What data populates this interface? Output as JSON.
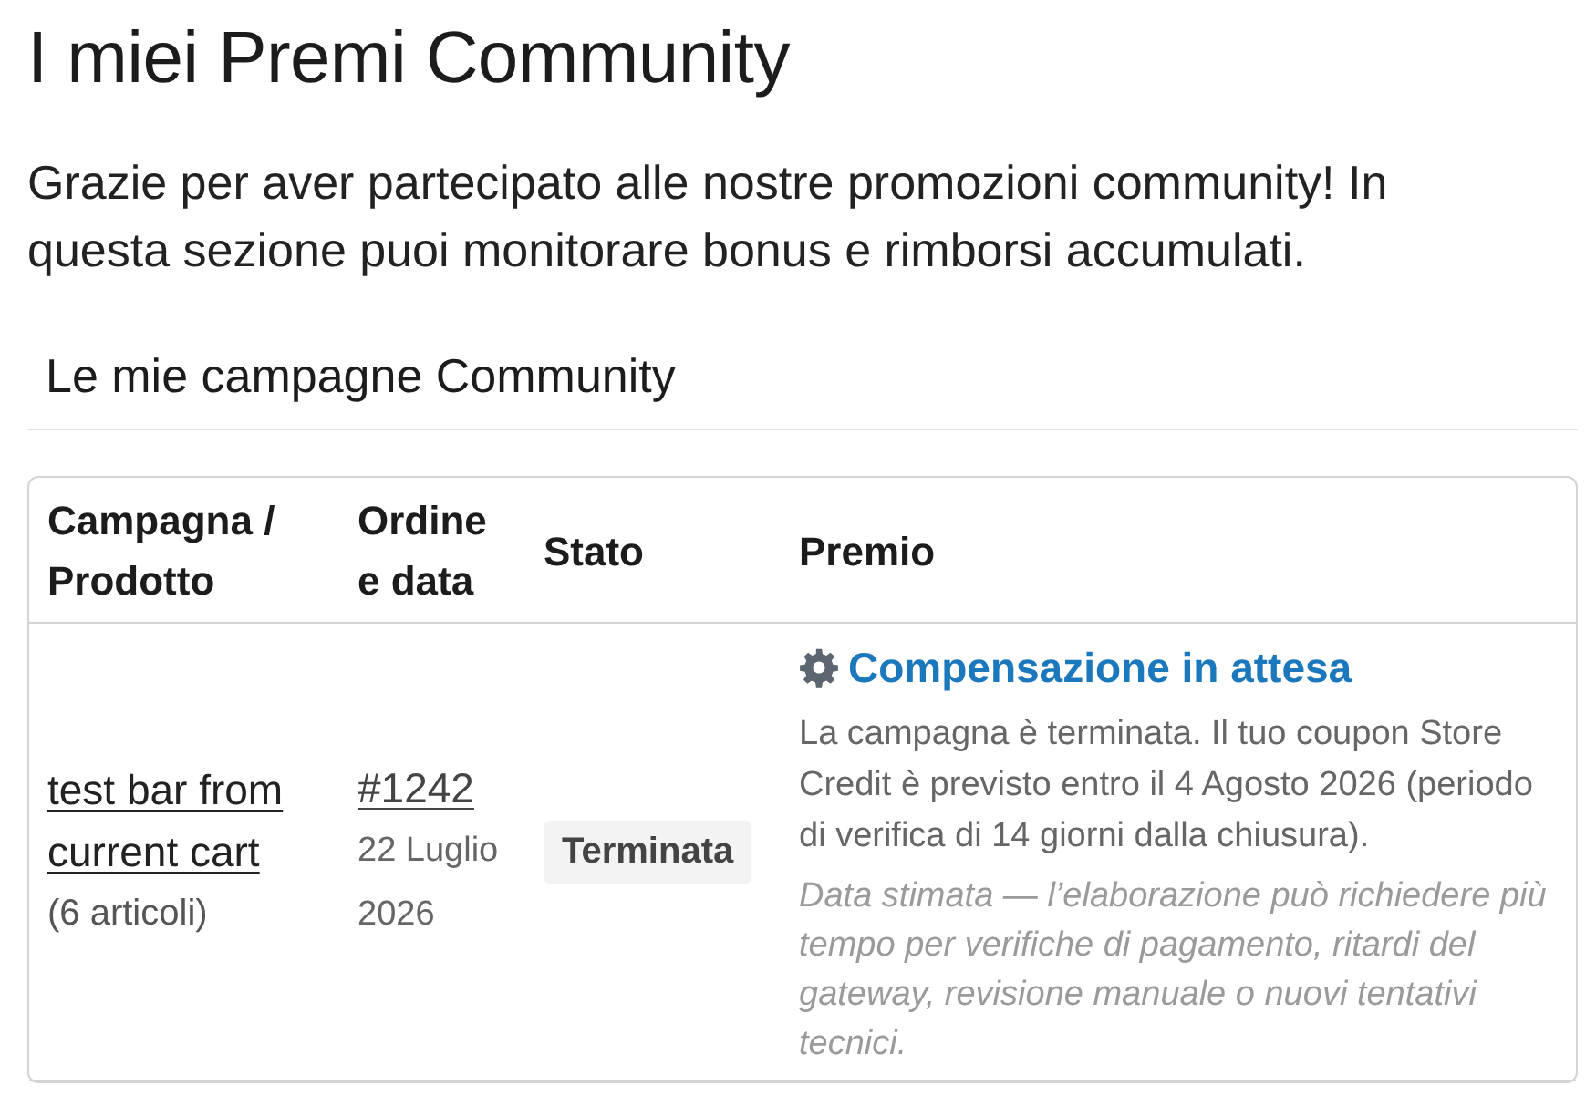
{
  "page": {
    "title": "I miei Premi Community",
    "intro": "Grazie per aver partecipato alle nostre promozioni community! In questa sezione puoi monitorare bonus e rimborsi accumulati."
  },
  "section": {
    "title": "Le mie campagne Community"
  },
  "table": {
    "columns": [
      "Campagna / Prodotto",
      "Ordine e data",
      "Stato",
      "Premio"
    ],
    "rows": [
      {
        "product": {
          "name": "test bar from current cart",
          "count": "(6 articoli)"
        },
        "order": {
          "number": "#1242",
          "date": "22 Luglio 2026"
        },
        "status": "Terminata",
        "reward": {
          "title": "Compensazione in attesa",
          "message": "La campagna è terminata. Il tuo coupon Store Credit è previsto entro il 4 Agosto 2026 (periodo di verifica di 14 giorni dalla chiusura).",
          "note": "Data stimata — l’elaborazione può richiedere più tempo per verifiche di pagamento, ritardi del gateway, revisione manuale o nuovi tentativi tecnici."
        }
      }
    ]
  }
}
